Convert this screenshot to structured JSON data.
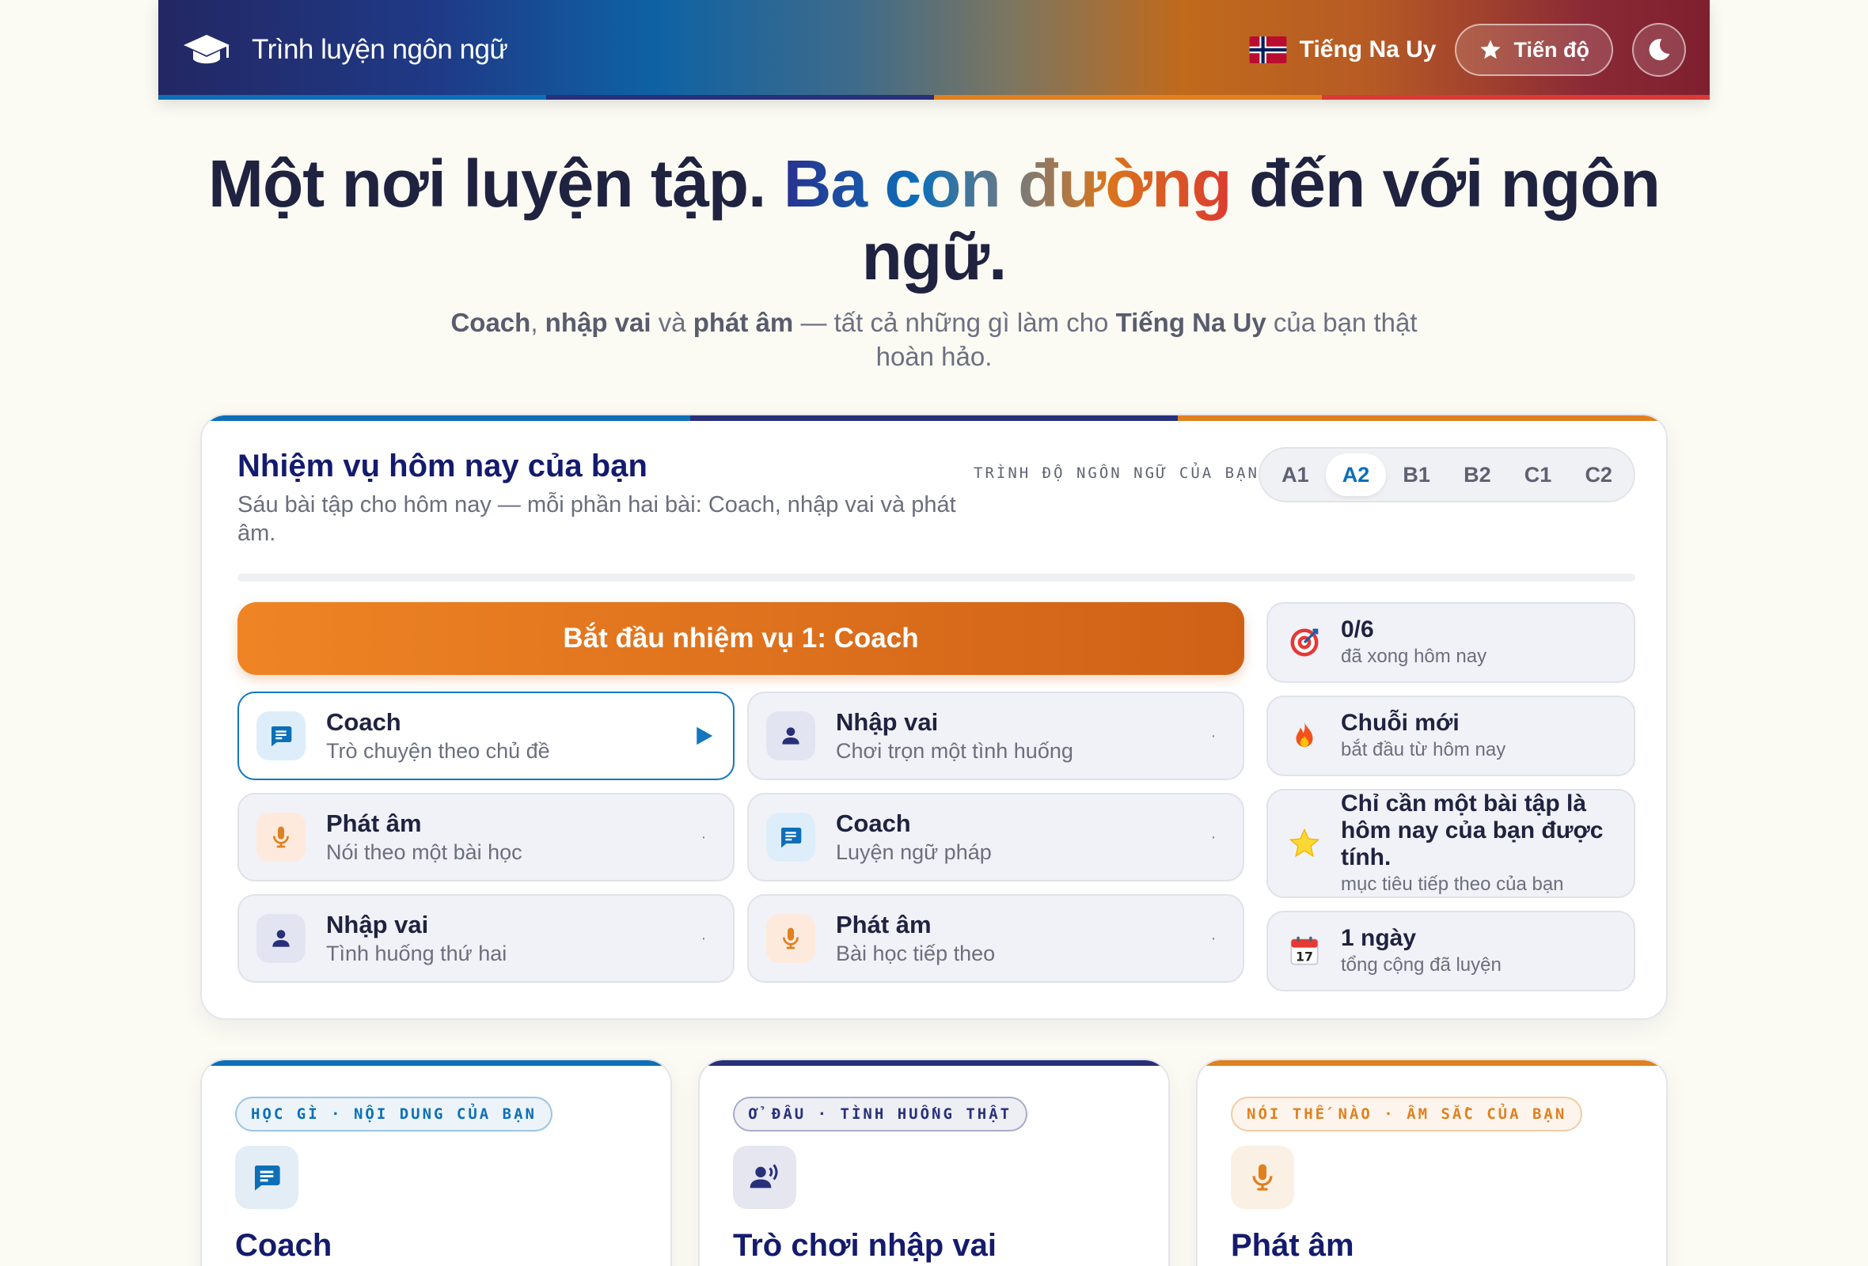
{
  "colors": {
    "navy": "#28307a",
    "blue": "#0d6fb8",
    "orange": "#e0801f",
    "red": "#d93a36",
    "accent_active": "#1576bf"
  },
  "header": {
    "brand_icon": "graduation-cap-icon",
    "app_title": "Trình luyện ngôn ngữ",
    "language_flag": "norway-flag-icon",
    "language_label": "Tiếng Na Uy",
    "progress_icon": "star-icon",
    "progress_label": "Tiến độ",
    "theme_icon": "moon-icon"
  },
  "hero": {
    "title_part1": "Một nơi luyện tập. ",
    "title_accent": "Ba con đường",
    "title_part2": " đến với ngôn ngữ.",
    "sub_b1": "Coach",
    "sub_t1": ", ",
    "sub_b2": "nhập vai",
    "sub_t2": " và ",
    "sub_b3": "phát âm",
    "sub_t3": " — tất cả những gì làm cho ",
    "sub_b4": "Tiếng Na Uy",
    "sub_t4": " của bạn thật hoàn hảo."
  },
  "mission": {
    "title": "Nhiệm vụ hôm nay của bạn",
    "description": "Sáu bài tập cho hôm nay — mỗi phần hai bài: Coach, nhập vai và phát âm.",
    "level_label": "TRÌNH ĐỘ NGÔN NGỮ CỦA BẠN",
    "levels": [
      "A1",
      "A2",
      "B1",
      "B2",
      "C1",
      "C2"
    ],
    "selected_level": "A2",
    "progress_fraction": 0,
    "start_label": "Bắt đầu nhiệm vụ 1: Coach",
    "tasks": [
      {
        "kind": "coach",
        "icon": "chat-icon",
        "title": "Coach",
        "subtitle": "Trò chuyện theo chủ đề",
        "state": "active"
      },
      {
        "kind": "role",
        "icon": "person-icon",
        "title": "Nhập vai",
        "subtitle": "Chơi trọn một tình huống",
        "state": "pending"
      },
      {
        "kind": "pron",
        "icon": "microphone-icon",
        "title": "Phát âm",
        "subtitle": "Nói theo một bài học",
        "state": "pending"
      },
      {
        "kind": "coach",
        "icon": "chat-icon",
        "title": "Coach",
        "subtitle": "Luyện ngữ pháp",
        "state": "pending"
      },
      {
        "kind": "role",
        "icon": "person-icon",
        "title": "Nhập vai",
        "subtitle": "Tình huống thứ hai",
        "state": "pending"
      },
      {
        "kind": "pron",
        "icon": "microphone-icon",
        "title": "Phát âm",
        "subtitle": "Bài học tiếp theo",
        "state": "pending"
      }
    ],
    "task_pending_marker": "·",
    "stats": [
      {
        "icon": "target-icon",
        "main": "0/6",
        "sub": "đã xong hôm nay"
      },
      {
        "icon": "fire-icon",
        "main": "Chuỗi mới",
        "sub": "bắt đầu từ hôm nay"
      },
      {
        "icon": "star-icon",
        "main": "Chỉ cần một bài tập là hôm nay của bạn được tính.",
        "sub": "mục tiêu tiếp theo của bạn"
      },
      {
        "icon": "calendar-icon",
        "main": "1 ngày",
        "sub": "tổng cộng đã luyện",
        "calendar_day": "17"
      }
    ]
  },
  "features": [
    {
      "tag": "HỌC GÌ · NỘI DUNG CỦA BẠN",
      "icon": "chat-icon",
      "title": "Coach",
      "color": "#0d6fb8"
    },
    {
      "tag": "Ở ĐÂU · TÌNH HUỐNG THẬT",
      "icon": "speaking-person-icon",
      "title": "Trò chơi nhập vai",
      "color": "#28307a"
    },
    {
      "tag": "NÓI THẾ NÀO · ÂM SẮC CỦA BẠN",
      "icon": "microphone-icon",
      "title": "Phát âm",
      "color": "#e0801f"
    }
  ]
}
